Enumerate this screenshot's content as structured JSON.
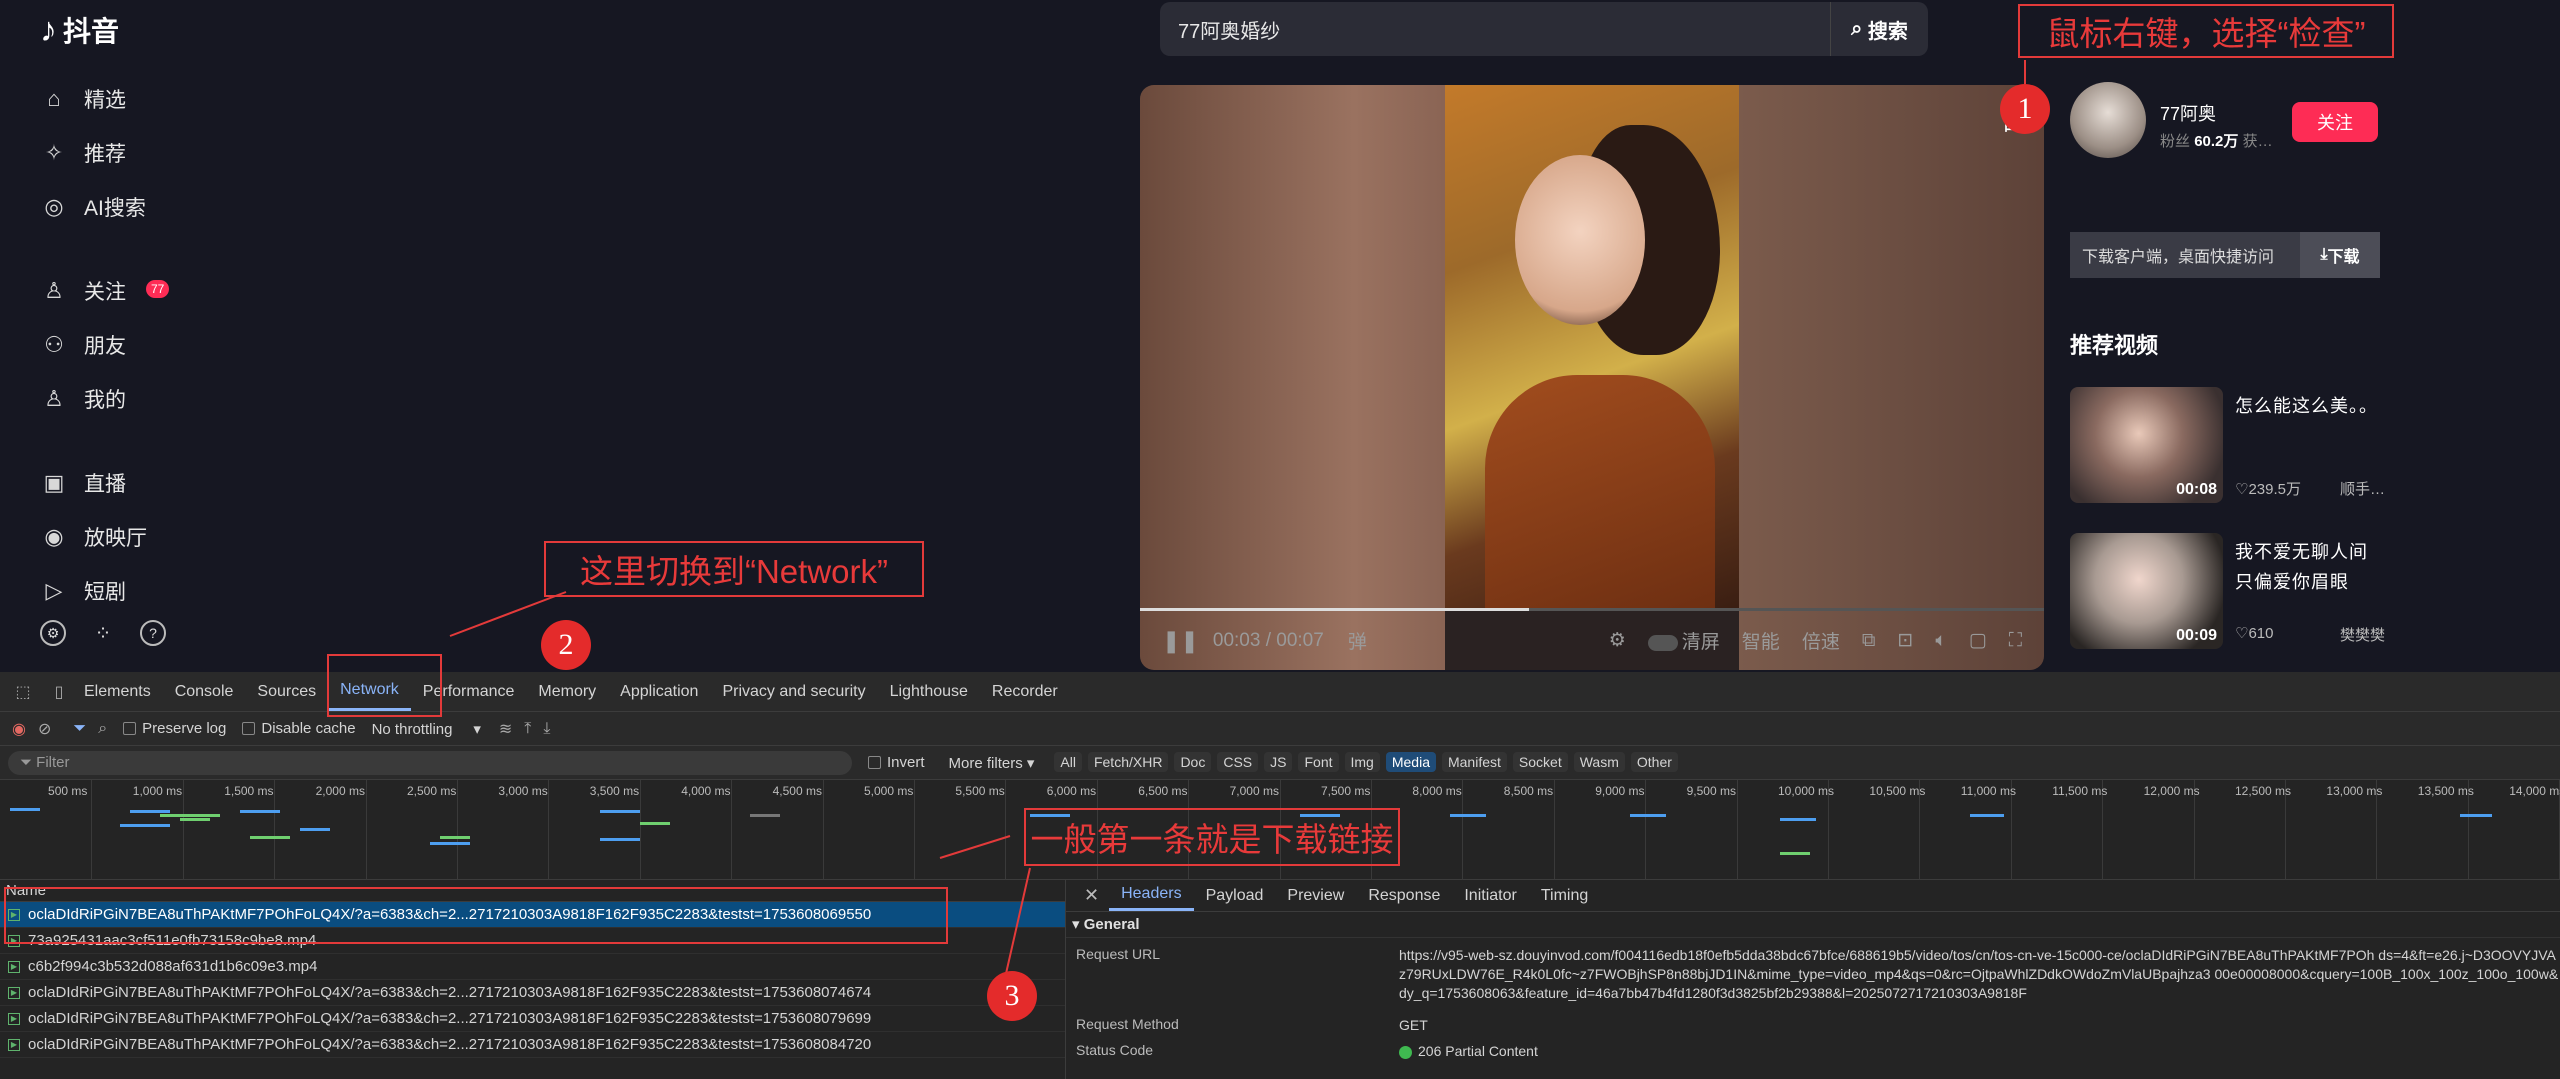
{
  "app": {
    "logo_mark": "♪",
    "logo_text": "抖音"
  },
  "sidebar": {
    "items": [
      {
        "label": "精选",
        "icon": "home-icon"
      },
      {
        "label": "推荐",
        "icon": "sparkle-icon"
      },
      {
        "label": "AI搜索",
        "icon": "ai-search-icon"
      },
      {
        "label": "关注",
        "icon": "follow-icon",
        "badge": "77"
      },
      {
        "label": "朋友",
        "icon": "friends-icon"
      },
      {
        "label": "我的",
        "icon": "user-icon"
      },
      {
        "label": "直播",
        "icon": "tv-icon"
      },
      {
        "label": "放映厅",
        "icon": "cinema-icon"
      },
      {
        "label": "短剧",
        "icon": "play-icon"
      }
    ]
  },
  "search": {
    "value": "77阿奥婚纱",
    "button": "搜索"
  },
  "video": {
    "time": "00:03 / 00:07",
    "progress": 0.43,
    "controls": [
      "清屏",
      "智能",
      "倍速"
    ],
    "corner": "白"
  },
  "author": {
    "name": "77阿奥",
    "fans_label": "粉丝",
    "fans_value": "60.2万",
    "extra": "获…",
    "follow": "关注"
  },
  "download": {
    "text": "下载客户端，桌面快捷访问",
    "button": "下载"
  },
  "recommend": {
    "title": "推荐视频",
    "items": [
      {
        "text": "怎么能这么美。。",
        "duration": "00:08",
        "likes": "239.5万",
        "author": "顺手…"
      },
      {
        "text": "我不爱无聊人间 只偏爱你眉眼",
        "duration": "00:09",
        "likes": "610",
        "author": "樊樊樊"
      }
    ]
  },
  "devtools": {
    "tabs": [
      "Elements",
      "Console",
      "Sources",
      "Network",
      "Performance",
      "Memory",
      "Application",
      "Privacy and security",
      "Lighthouse",
      "Recorder"
    ],
    "active_tab": "Network",
    "toolbar": {
      "preserve_log": "Preserve log",
      "disable_cache": "Disable cache",
      "throttling": "No throttling"
    },
    "filter": {
      "placeholder": "Filter",
      "invert": "Invert",
      "more": "More filters",
      "chips": [
        "All",
        "Fetch/XHR",
        "Doc",
        "CSS",
        "JS",
        "Font",
        "Img",
        "Media",
        "Manifest",
        "Socket",
        "Wasm",
        "Other"
      ],
      "active_chip": "Media"
    },
    "timeline_ticks": [
      "500 ms",
      "1,000 ms",
      "1,500 ms",
      "2,000 ms",
      "2,500 ms",
      "3,000 ms",
      "3,500 ms",
      "4,000 ms",
      "4,500 ms",
      "5,000 ms",
      "5,500 ms",
      "6,000 ms",
      "6,500 ms",
      "7,000 ms",
      "7,500 ms",
      "8,000 ms",
      "8,500 ms",
      "9,000 ms",
      "9,500 ms",
      "10,000 ms",
      "10,500 ms",
      "11,000 ms",
      "11,500 ms",
      "12,000 ms",
      "12,500 ms",
      "13,000 ms",
      "13,500 ms",
      "14,000 ms"
    ],
    "requests": {
      "header": "Name",
      "rows": [
        "oclaDIdRiPGiN7BEA8uThPAKtMF7POhFoLQ4X/?a=6383&ch=2...2717210303A9818F162F935C2283&testst=1753608069550",
        "73a925431aac3cf511e0fb73158c9be8.mp4",
        "c6b2f994c3b532d088af631d1b6c09e3.mp4",
        "oclaDIdRiPGiN7BEA8uThPAKtMF7POhFoLQ4X/?a=6383&ch=2...2717210303A9818F162F935C2283&testst=1753608074674",
        "oclaDIdRiPGiN7BEA8uThPAKtMF7POhFoLQ4X/?a=6383&ch=2...2717210303A9818F162F935C2283&testst=1753608079699",
        "oclaDIdRiPGiN7BEA8uThPAKtMF7POhFoLQ4X/?a=6383&ch=2...2717210303A9818F162F935C2283&testst=1753608084720"
      ]
    },
    "detail": {
      "tabs": [
        "Headers",
        "Payload",
        "Preview",
        "Response",
        "Initiator",
        "Timing"
      ],
      "section": "General",
      "request_url_key": "Request URL",
      "request_url": "https://v95-web-sz.douyinvod.com/f004116edb18f0efb5dda38bdc67bfce/688619b5/video/tos/cn/tos-cn-ve-15c000-ce/oclaDIdRiPGiN7BEA8uThPAKtMF7POh ds=4&ft=e26.j~D3OOVYJVAz79RUxLDW76E_R4k0L0fc~z7FWOBjhSP8n88bjJD1IN&mime_type=video_mp4&qs=0&rc=OjtpaWhlZDdkOWdoZmVlaUBpajhza3 00e00008000&cquery=100B_100x_100z_100o_100w&dy_q=1753608063&feature_id=46a7bb47b4fd1280f3d3825bf2b29388&l=2025072717210303A9818F",
      "method_key": "Request Method",
      "method": "GET",
      "status_key": "Status Code",
      "status": "206 Partial Content"
    }
  },
  "annotations": {
    "step1_text": "鼠标右键，选择“检查”",
    "step2_text": "这里切换到“Network”",
    "step3_text": "一般第一条就是下载链接",
    "num1": "1",
    "num2": "2",
    "num3": "3"
  }
}
